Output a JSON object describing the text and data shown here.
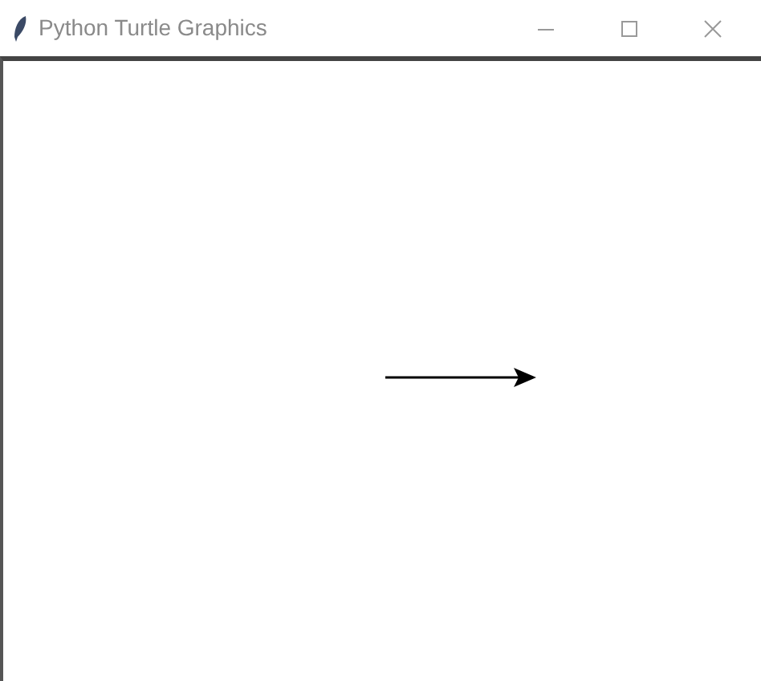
{
  "window": {
    "title": "Python Turtle Graphics"
  }
}
